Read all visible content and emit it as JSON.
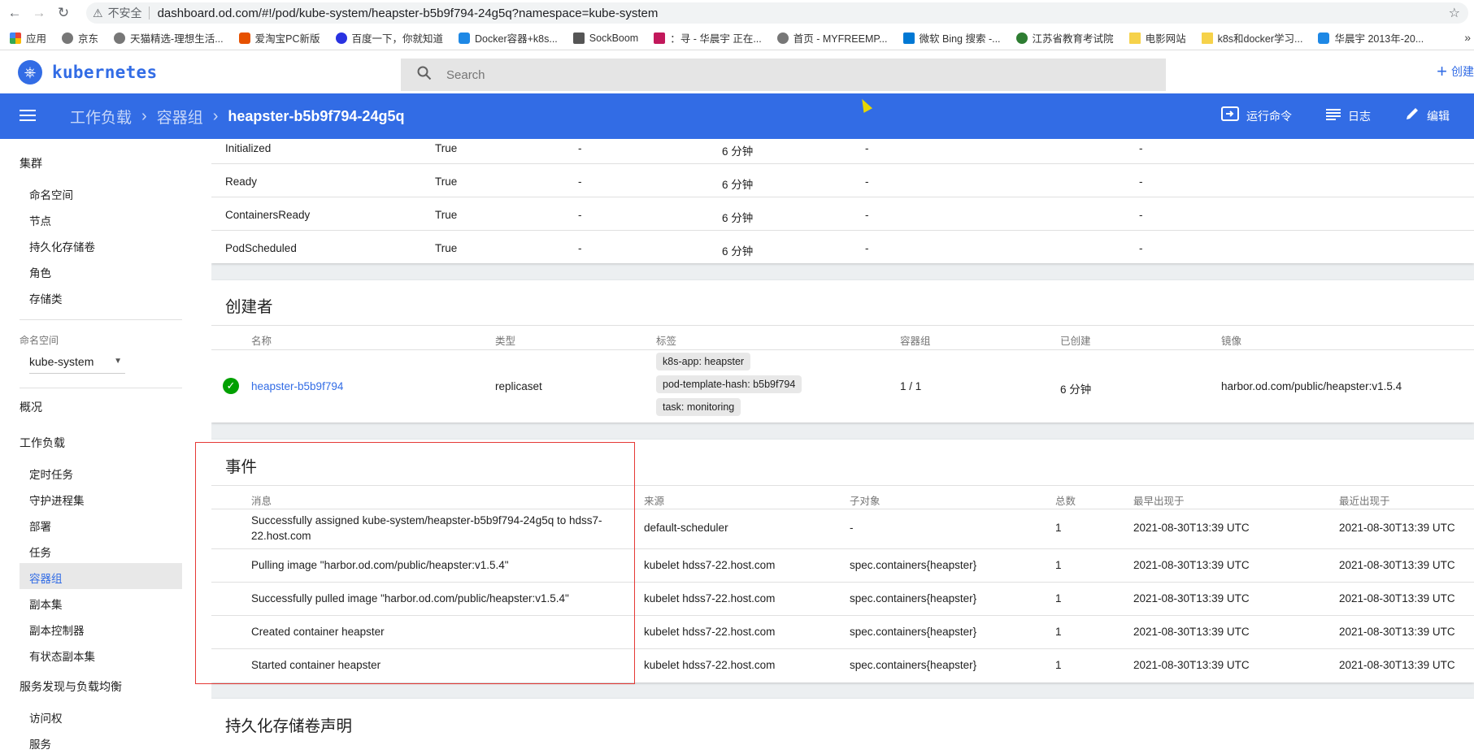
{
  "browser": {
    "insecure_label": "不安全",
    "url": "dashboard.od.com/#!/pod/kube-system/heapster-b5b9f794-24g5q?namespace=kube-system",
    "bookmarks": [
      "应用",
      "京东",
      "天猫精选-理想生活...",
      "爱淘宝PC新版",
      "百度一下，你就知道",
      "Docker容器+k8s...",
      "SockBoom",
      "：寻 - 华晨宇 正在...",
      "首页 - MYFREEMP...",
      "微软 Bing 搜索 -...",
      "江苏省教育考试院",
      "电影网站",
      "k8s和docker学习...",
      "华晨宇 2013年-20..."
    ],
    "more": "»"
  },
  "app": {
    "name": "kubernetes",
    "search_placeholder": "Search",
    "create_label": "创建"
  },
  "toolbar": {
    "breadcrumb": [
      "工作负载",
      "容器组"
    ],
    "current": "heapster-b5b9f794-24g5q",
    "exec_label": "运行命令",
    "logs_label": "日志",
    "edit_label": "编辑"
  },
  "sidebar": {
    "cluster": "集群",
    "cluster_items": [
      "命名空间",
      "节点",
      "持久化存储卷",
      "角色",
      "存储类"
    ],
    "namespace_label": "命名空间",
    "namespace_value": "kube-system",
    "overview": "概况",
    "workloads": "工作负载",
    "workload_items": [
      "定时任务",
      "守护进程集",
      "部署",
      "任务",
      "容器组",
      "副本集",
      "副本控制器",
      "有状态副本集"
    ],
    "discovery": "服务发现与负载均衡",
    "discovery_items": [
      "访问权",
      "服务"
    ]
  },
  "conditions": [
    {
      "type": "Initialized",
      "status": "True",
      "probe": "-",
      "transition": "6 分钟",
      "reason": "-",
      "message": "-"
    },
    {
      "type": "Ready",
      "status": "True",
      "probe": "-",
      "transition": "6 分钟",
      "reason": "-",
      "message": "-"
    },
    {
      "type": "ContainersReady",
      "status": "True",
      "probe": "-",
      "transition": "6 分钟",
      "reason": "-",
      "message": "-"
    },
    {
      "type": "PodScheduled",
      "status": "True",
      "probe": "-",
      "transition": "6 分钟",
      "reason": "-",
      "message": "-"
    }
  ],
  "creator": {
    "title": "创建者",
    "headers": [
      "名称",
      "类型",
      "标签",
      "容器组",
      "已创建",
      "镜像"
    ],
    "name": "heapster-b5b9f794",
    "kind": "replicaset",
    "labels": [
      "k8s-app: heapster",
      "pod-template-hash: b5b9f794",
      "task: monitoring"
    ],
    "pods": "1 / 1",
    "created": "6 分钟",
    "image": "harbor.od.com/public/heapster:v1.5.4"
  },
  "events": {
    "title": "事件",
    "headers": [
      "消息",
      "来源",
      "子对象",
      "总数",
      "最早出现于",
      "最近出现于"
    ],
    "rows": [
      {
        "message": "Successfully assigned kube-system/heapster-b5b9f794-24g5q to hdss7-22.host.com",
        "source": "default-scheduler",
        "object": "-",
        "count": "1",
        "first": "2021-08-30T13:39 UTC",
        "last": "2021-08-30T13:39 UTC"
      },
      {
        "message": "Pulling image \"harbor.od.com/public/heapster:v1.5.4\"",
        "source": "kubelet hdss7-22.host.com",
        "object": "spec.containers{heapster}",
        "count": "1",
        "first": "2021-08-30T13:39 UTC",
        "last": "2021-08-30T13:39 UTC"
      },
      {
        "message": "Successfully pulled image \"harbor.od.com/public/heapster:v1.5.4\"",
        "source": "kubelet hdss7-22.host.com",
        "object": "spec.containers{heapster}",
        "count": "1",
        "first": "2021-08-30T13:39 UTC",
        "last": "2021-08-30T13:39 UTC"
      },
      {
        "message": "Created container heapster",
        "source": "kubelet hdss7-22.host.com",
        "object": "spec.containers{heapster}",
        "count": "1",
        "first": "2021-08-30T13:39 UTC",
        "last": "2021-08-30T13:39 UTC"
      },
      {
        "message": "Started container heapster",
        "source": "kubelet hdss7-22.host.com",
        "object": "spec.containers{heapster}",
        "count": "1",
        "first": "2021-08-30T13:39 UTC",
        "last": "2021-08-30T13:39 UTC"
      }
    ]
  },
  "pvc": {
    "title": "持久化存储卷声明"
  },
  "colors": {
    "primary": "#326ce5",
    "success": "#00a000",
    "highlight": "#e53935"
  }
}
